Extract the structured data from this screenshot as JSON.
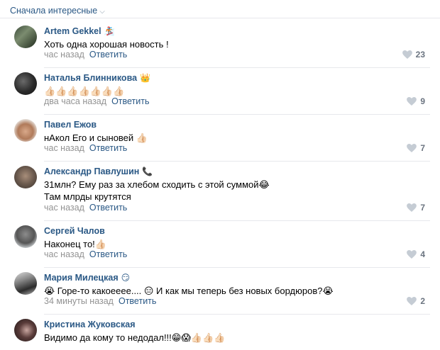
{
  "sort": {
    "label": "Сначала интересные",
    "chevron": "⌵"
  },
  "reply_label": "Ответить",
  "comments": [
    {
      "author": "Artem Gekkel",
      "badge": "🏂",
      "lines": [
        "Хоть одна хорошая новость !"
      ],
      "time": "час назад",
      "likes": "23",
      "avatar": "avatar-1"
    },
    {
      "author": "Наталья Блинникова",
      "badge": "👑",
      "lines": [
        "👍🏻👍🏻👍🏻👍🏻👍🏻👍🏻👍🏻"
      ],
      "time": "два часа назад",
      "likes": "9",
      "avatar": "avatar-2"
    },
    {
      "author": "Павел Ежов",
      "badge": "",
      "lines": [
        "нАкол Его и сыновей 👍🏻"
      ],
      "time": "час назад",
      "likes": "7",
      "avatar": "avatar-3"
    },
    {
      "author": "Александр Павлушин",
      "badge": "📞",
      "lines": [
        "31млн? Ему раз за хлебом сходить с этой суммой😂",
        "Там млрды крутятся"
      ],
      "time": "час назад",
      "likes": "7",
      "avatar": "avatar-4"
    },
    {
      "author": "Сергей Чалов",
      "badge": "",
      "lines": [
        "Наконец то!👍🏻"
      ],
      "time": "час назад",
      "likes": "4",
      "avatar": "avatar-5"
    },
    {
      "author": "Мария Милецкая",
      "badge": "😏",
      "lines": [
        "😭 Горе-то какоееее.... 😑 И как мы теперь без новых бордюров?😭"
      ],
      "time": "34 минуты назад",
      "likes": "2",
      "avatar": "avatar-6"
    },
    {
      "author": "Кристина Жуковская",
      "badge": "",
      "lines": [
        "Видимо да кому то недодал!!!😁😱👍🏻👍🏻👍🏻"
      ],
      "time": "",
      "likes": "",
      "avatar": "avatar-7"
    }
  ],
  "colors": {
    "link": "#2a5885",
    "meta": "#939393",
    "divider": "#e7e8ec",
    "likes": "#6b7480"
  }
}
